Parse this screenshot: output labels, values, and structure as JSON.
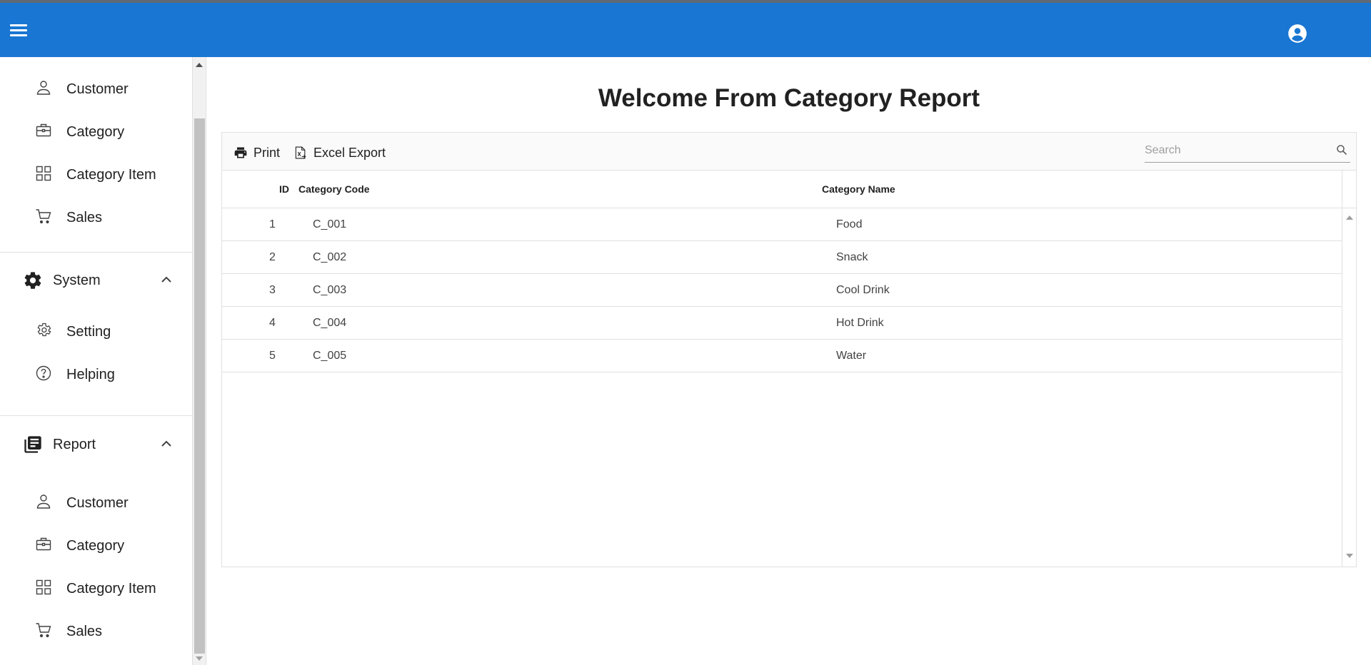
{
  "topbar": {
    "menu_icon": "hamburger-menu-icon",
    "account_icon": "account-circle-icon",
    "accent": "#1976d2"
  },
  "sidebar": {
    "items_top": [
      {
        "label": "Customer",
        "icon": "person-icon"
      },
      {
        "label": "Category",
        "icon": "briefcase-icon"
      },
      {
        "label": "Category Item",
        "icon": "grid-icon"
      },
      {
        "label": "Sales",
        "icon": "cart-icon"
      }
    ],
    "groups": [
      {
        "label": "System",
        "icon": "gear-icon",
        "items": [
          {
            "label": "Setting",
            "icon": "gear-outline-icon"
          },
          {
            "label": "Helping",
            "icon": "help-circle-icon"
          }
        ]
      },
      {
        "label": "Report",
        "icon": "report-icon",
        "items": [
          {
            "label": "Customer",
            "icon": "person-icon"
          },
          {
            "label": "Category",
            "icon": "briefcase-icon"
          },
          {
            "label": "Category Item",
            "icon": "grid-icon"
          },
          {
            "label": "Sales",
            "icon": "cart-icon"
          }
        ]
      }
    ]
  },
  "main": {
    "title": "Welcome From Category Report",
    "toolbar": {
      "print_label": "Print",
      "excel_label": "Excel Export"
    },
    "search": {
      "placeholder": "Search",
      "value": ""
    },
    "table": {
      "columns": [
        "ID",
        "Category Code",
        "Category Name"
      ],
      "rows": [
        [
          "1",
          "C_001",
          "Food"
        ],
        [
          "2",
          "C_002",
          "Snack"
        ],
        [
          "3",
          "C_003",
          "Cool Drink"
        ],
        [
          "4",
          "C_004",
          "Hot Drink"
        ],
        [
          "5",
          "C_005",
          "Water"
        ]
      ]
    }
  }
}
